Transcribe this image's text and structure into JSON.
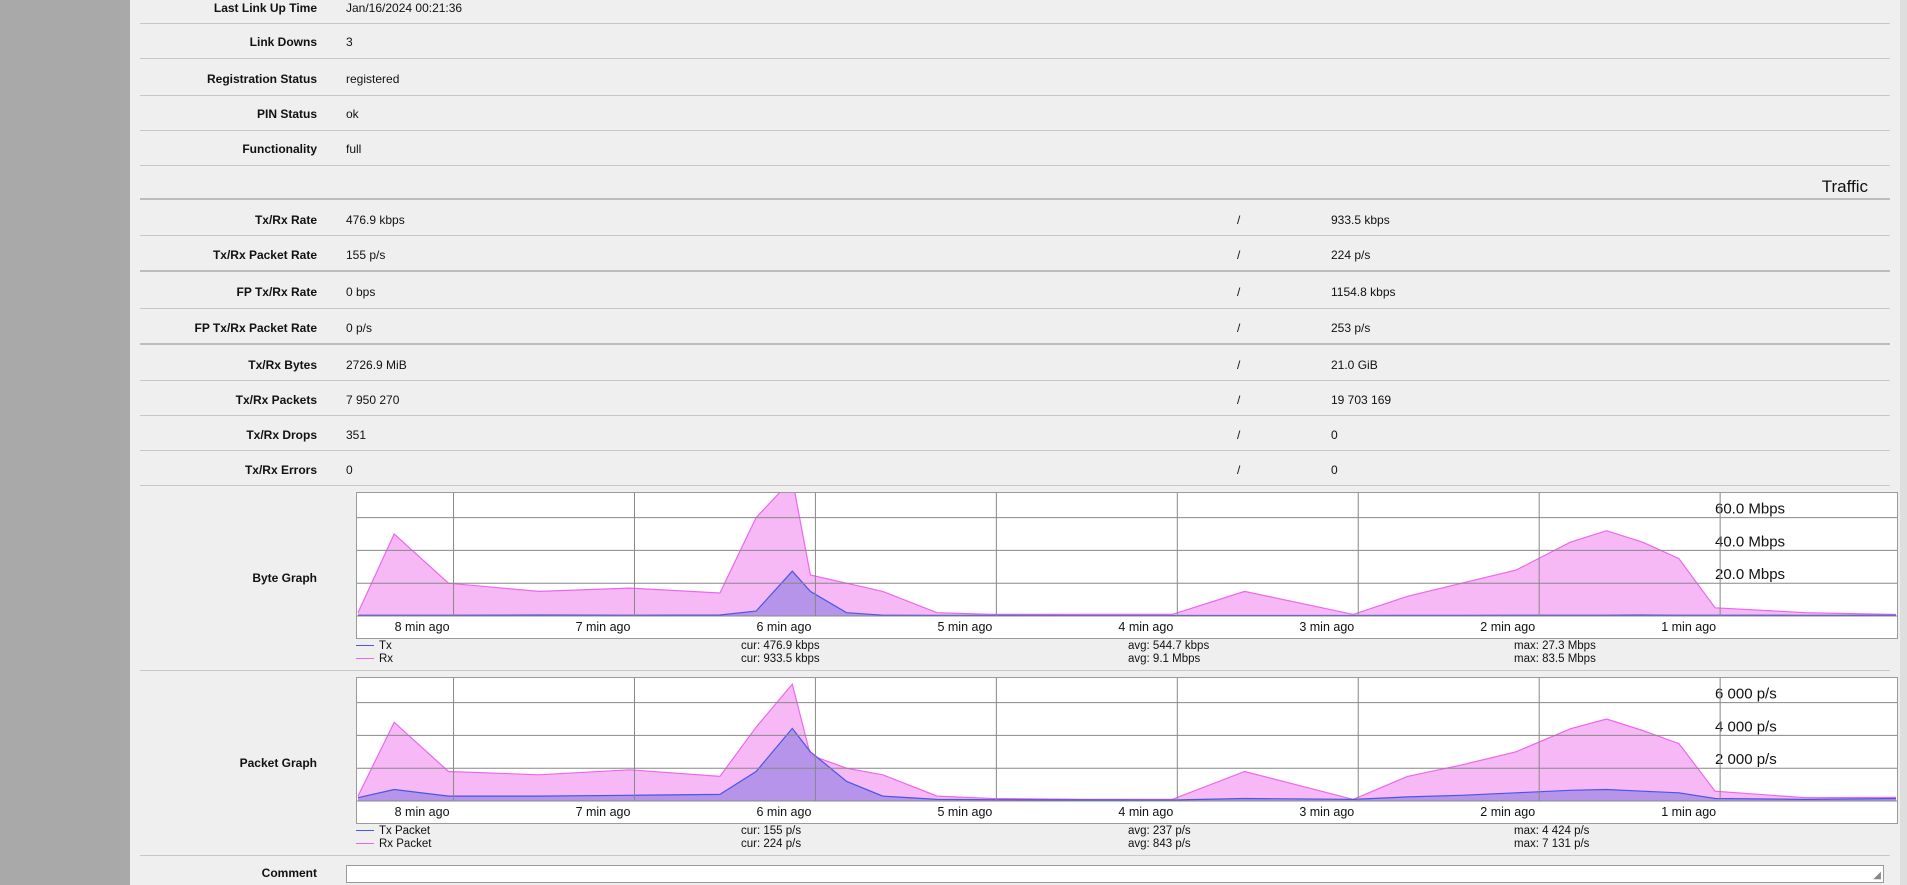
{
  "status": {
    "last_link_up_time": {
      "label": "Last Link Up Time",
      "value": "Jan/16/2024 00:21:36"
    },
    "link_downs": {
      "label": "Link Downs",
      "value": "3"
    },
    "registration_status": {
      "label": "Registration Status",
      "value": "registered"
    },
    "pin_status": {
      "label": "PIN Status",
      "value": "ok"
    },
    "functionality": {
      "label": "Functionality",
      "value": "full"
    }
  },
  "traffic": {
    "heading": "Traffic",
    "separator": "/",
    "rows": [
      {
        "label": "Tx/Rx Rate",
        "tx": "476.9 kbps",
        "rx": "933.5 kbps"
      },
      {
        "label": "Tx/Rx Packet Rate",
        "tx": "155 p/s",
        "rx": "224 p/s"
      },
      {
        "label": "FP Tx/Rx Rate",
        "tx": "0 bps",
        "rx": "1154.8 kbps"
      },
      {
        "label": "FP Tx/Rx Packet Rate",
        "tx": "0 p/s",
        "rx": "253 p/s"
      },
      {
        "label": "Tx/Rx Bytes",
        "tx": "2726.9 MiB",
        "rx": "21.0 GiB"
      },
      {
        "label": "Tx/Rx Packets",
        "tx": "7 950 270",
        "rx": "19 703 169"
      },
      {
        "label": "Tx/Rx Drops",
        "tx": "351",
        "rx": "0"
      },
      {
        "label": "Tx/Rx Errors",
        "tx": "0",
        "rx": "0"
      }
    ]
  },
  "colors": {
    "tx": "#4b55e8",
    "rx": "#ee66ee",
    "rx_fill": "#f6b9f6",
    "overlap_fill": "#a98de8",
    "grid": "#888888"
  },
  "byte_graph": {
    "label": "Byte Graph",
    "y_labels": [
      "60.0 Mbps",
      "40.0 Mbps",
      "20.0 Mbps"
    ],
    "x_labels": [
      "8 min ago",
      "7 min ago",
      "6 min ago",
      "5 min ago",
      "4 min ago",
      "3 min ago",
      "2 min ago",
      "1 min ago"
    ],
    "legend": [
      {
        "name": "Tx",
        "cur": "cur: 476.9 kbps",
        "avg": "avg: 544.7 kbps",
        "max": "max: 27.3 Mbps"
      },
      {
        "name": "Rx",
        "cur": "cur: 933.5 kbps",
        "avg": "avg: 9.1 Mbps",
        "max": "max: 83.5 Mbps"
      }
    ]
  },
  "packet_graph": {
    "label": "Packet Graph",
    "y_labels": [
      "6 000 p/s",
      "4 000 p/s",
      "2 000 p/s"
    ],
    "x_labels": [
      "8 min ago",
      "7 min ago",
      "6 min ago",
      "5 min ago",
      "4 min ago",
      "3 min ago",
      "2 min ago",
      "1 min ago"
    ],
    "legend": [
      {
        "name": "Tx Packet",
        "cur": "cur: 155 p/s",
        "avg": "avg: 237 p/s",
        "max": "max: 4 424 p/s"
      },
      {
        "name": "Rx Packet",
        "cur": "cur: 224 p/s",
        "avg": "avg: 843 p/s",
        "max": "max: 7 131 p/s"
      }
    ]
  },
  "comment": {
    "label": "Comment",
    "value": ""
  },
  "chart_data": [
    {
      "type": "area",
      "title": "Byte Graph",
      "unit": "Mbps",
      "ylim": [
        0,
        75
      ],
      "x": [
        -8.5,
        -8.3,
        -8.0,
        -7.5,
        -7.0,
        -6.5,
        -6.3,
        -6.1,
        -6.0,
        -5.8,
        -5.6,
        -5.3,
        -5.0,
        -4.5,
        -4.0,
        -3.6,
        -3.0,
        -2.7,
        -2.4,
        -2.1,
        -1.8,
        -1.6,
        -1.4,
        -1.2,
        -1.0,
        -0.5,
        0.0
      ],
      "series": [
        {
          "name": "Tx",
          "values": [
            0.5,
            0.5,
            0.5,
            0.6,
            0.5,
            0.6,
            3,
            27.3,
            15,
            2,
            0.5,
            0.4,
            0.4,
            0.3,
            0.3,
            0.3,
            0.3,
            0.4,
            0.4,
            0.5,
            0.5,
            0.5,
            0.6,
            0.5,
            0.5,
            0.4,
            0.5
          ]
        },
        {
          "name": "Rx",
          "values": [
            2,
            50,
            20,
            15,
            17,
            14,
            60,
            83.5,
            25,
            20,
            15,
            2,
            1,
            1,
            1,
            15,
            1,
            12,
            20,
            28,
            45,
            52,
            45,
            35,
            5,
            2,
            0.9
          ]
        }
      ],
      "grid": true
    },
    {
      "type": "area",
      "title": "Packet Graph",
      "unit": "p/s",
      "ylim": [
        0,
        7500
      ],
      "x": [
        -8.5,
        -8.3,
        -8.0,
        -7.5,
        -7.0,
        -6.5,
        -6.3,
        -6.1,
        -6.0,
        -5.8,
        -5.6,
        -5.3,
        -5.0,
        -4.5,
        -4.0,
        -3.6,
        -3.0,
        -2.7,
        -2.4,
        -2.1,
        -1.8,
        -1.6,
        -1.4,
        -1.2,
        -1.0,
        -0.5,
        0.0
      ],
      "series": [
        {
          "name": "Tx Packet",
          "values": [
            200,
            700,
            300,
            300,
            350,
            400,
            1800,
            4424,
            3000,
            1200,
            300,
            100,
            80,
            70,
            60,
            150,
            100,
            250,
            350,
            500,
            650,
            700,
            600,
            500,
            150,
            100,
            155
          ]
        },
        {
          "name": "Rx Packet",
          "values": [
            300,
            4800,
            1800,
            1600,
            1900,
            1500,
            4500,
            7131,
            2800,
            2000,
            1600,
            300,
            150,
            100,
            100,
            1800,
            100,
            1500,
            2200,
            3000,
            4400,
            5000,
            4300,
            3500,
            600,
            200,
            224
          ]
        }
      ],
      "grid": true
    }
  ]
}
